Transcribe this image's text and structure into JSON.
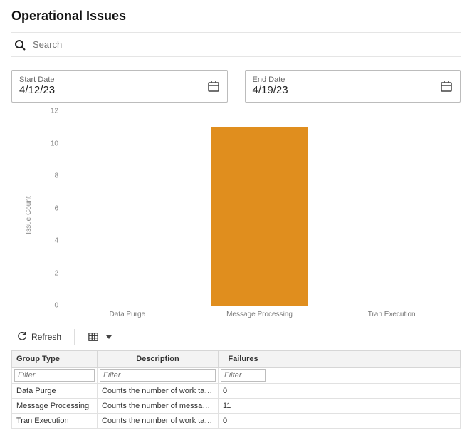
{
  "title": "Operational Issues",
  "search": {
    "placeholder": "Search"
  },
  "date": {
    "start_label": "Start Date",
    "start_value": "4/12/23",
    "end_label": "End Date",
    "end_value": "4/19/23"
  },
  "chart_data": {
    "type": "bar",
    "categories": [
      "Data Purge",
      "Message Processing",
      "Tran Execution"
    ],
    "values": [
      0,
      11,
      0
    ],
    "ylabel": "Issue Count",
    "xlabel": "",
    "ylim": [
      0,
      12
    ],
    "yticks": [
      0,
      2,
      4,
      6,
      8,
      10,
      12
    ],
    "bar_color": "#e08e1e"
  },
  "toolbar": {
    "refresh": "Refresh"
  },
  "table": {
    "headers": {
      "group": "Group Type",
      "desc": "Description",
      "fail": "Failures"
    },
    "filter_placeholder": "Filter",
    "rows": [
      {
        "group": "Data Purge",
        "desc": "Counts the number of work tasks that f…",
        "fail": "0"
      },
      {
        "group": "Message Processing",
        "desc": "Counts the number of messages that fa…",
        "fail": "11"
      },
      {
        "group": "Tran Execution",
        "desc": "Counts the number of work tasks that f…",
        "fail": "0"
      }
    ]
  }
}
